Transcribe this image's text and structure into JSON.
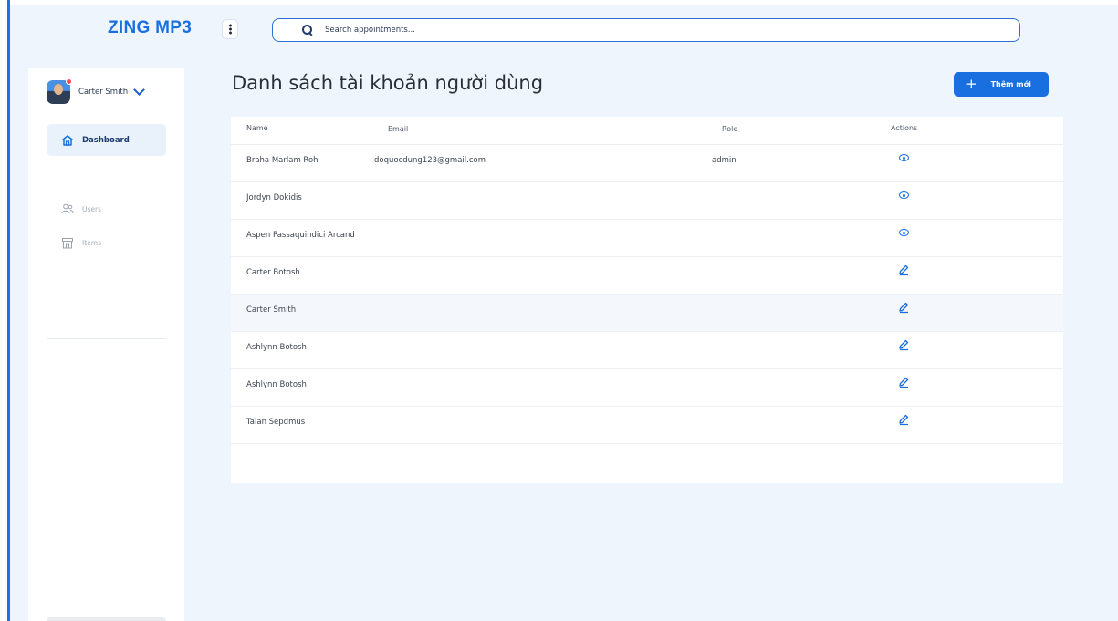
{
  "app": {
    "logo": "ZING MP3"
  },
  "search": {
    "placeholder": "Search appointments..."
  },
  "user": {
    "name": "Carter Smith"
  },
  "sidebar": {
    "items": [
      {
        "label": "Dashboard",
        "icon": "home-icon",
        "active": true
      },
      {
        "label": "Users",
        "icon": "users-icon",
        "active": false
      },
      {
        "label": "Items",
        "icon": "store-icon",
        "active": false
      }
    ]
  },
  "main": {
    "title": "Danh sách tài khoản người dùng",
    "add_button": "Thêm mới"
  },
  "table": {
    "columns": [
      "Name",
      "Email",
      "Role",
      "Actions"
    ],
    "rows": [
      {
        "name": "Braha Marlam Roh",
        "email": "doquocdung123@gmail.com",
        "role": "admin",
        "action": "view-icon"
      },
      {
        "name": "Jordyn Dokidis",
        "email": "",
        "role": "",
        "action": "view-icon"
      },
      {
        "name": "Aspen Passaquindici Arcand",
        "email": "",
        "role": "",
        "action": "view-icon"
      },
      {
        "name": "Carter Botosh",
        "email": "",
        "role": "",
        "action": "edit-icon"
      },
      {
        "name": "Carter Smith",
        "email": "",
        "role": "",
        "action": "edit-icon"
      },
      {
        "name": "Ashlynn Botosh",
        "email": "",
        "role": "",
        "action": "edit-icon"
      },
      {
        "name": "Ashlynn Botosh",
        "email": "",
        "role": "",
        "action": "edit-icon"
      },
      {
        "name": "Talan Sepdmus",
        "email": "",
        "role": "",
        "action": "edit-icon"
      }
    ]
  },
  "colors": {
    "accent": "#1a6fe0",
    "background": "#eef5fd"
  }
}
